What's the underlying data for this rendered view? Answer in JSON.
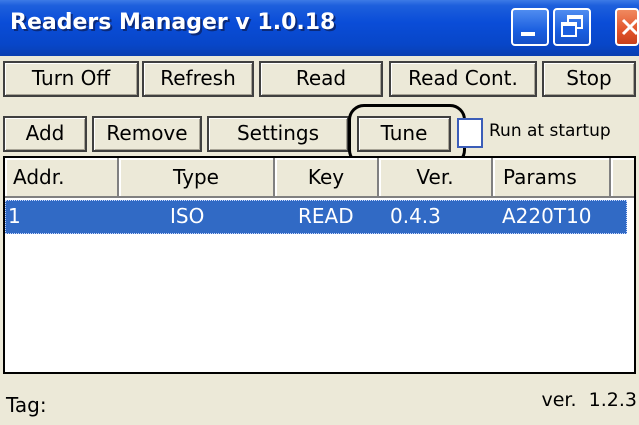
{
  "window": {
    "title": "Readers Manager v 1.0.18"
  },
  "toolbar_row1": {
    "turn_off": "Turn Off",
    "refresh": "Refresh",
    "read": "Read",
    "read_cont": "Read Cont.",
    "stop": "Stop"
  },
  "toolbar_row2": {
    "add": "Add",
    "remove": "Remove",
    "settings": "Settings",
    "tune": "Tune",
    "run_at_startup_label": "Run at startup",
    "run_at_startup_checked": false
  },
  "readers_table": {
    "columns": [
      "Addr.",
      "Type",
      "Key",
      "Ver.",
      "Params"
    ],
    "rows": [
      {
        "addr": "1",
        "type": "ISO",
        "key": "READ",
        "ver": "0.4.3",
        "params": "A220T10",
        "selected": true
      }
    ]
  },
  "status": {
    "tag_label": "Tag:",
    "version_label": "ver.",
    "version_value": "1.2.3"
  },
  "colors": {
    "titlebar": "#0a4dd8",
    "selection": "#316ac5",
    "window_bg": "#ece9d8"
  }
}
